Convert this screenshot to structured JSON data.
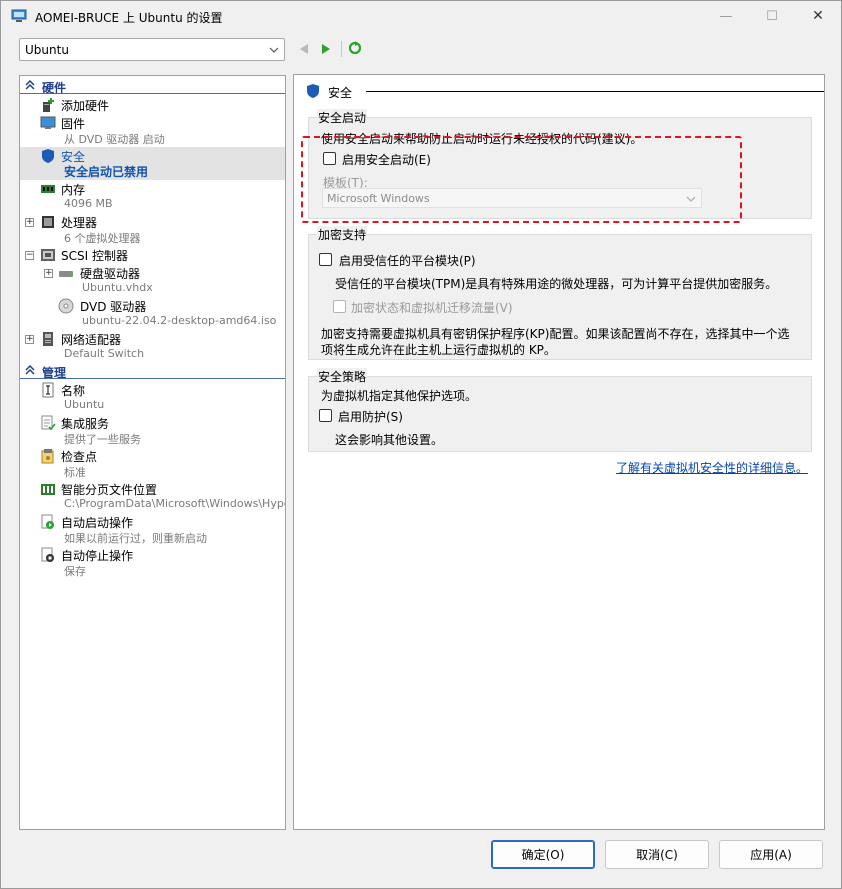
{
  "window": {
    "title": "AOMEI-BRUCE 上 Ubuntu 的设置",
    "min_glyph": "—",
    "max_glyph": "☐",
    "close_glyph": "✕"
  },
  "vm_selector": {
    "value": "Ubuntu"
  },
  "tree": {
    "hardware_label": "硬件",
    "management_label": "管理",
    "items": [
      {
        "label": "添加硬件",
        "sub": "",
        "icon": "add-hardware-icon"
      },
      {
        "label": "固件",
        "sub": "从 DVD 驱动器 启动",
        "icon": "firmware-icon"
      },
      {
        "label": "安全",
        "sub": "安全启动已禁用",
        "icon": "shield-icon"
      },
      {
        "label": "内存",
        "sub": "4096 MB",
        "icon": "memory-icon"
      },
      {
        "label": "处理器",
        "sub": "6 个虚拟处理器",
        "icon": "processor-icon"
      },
      {
        "label": "SCSI 控制器",
        "sub": "",
        "icon": "scsi-controller-icon"
      },
      {
        "label": "硬盘驱动器",
        "sub": "Ubuntu.vhdx",
        "icon": "hard-drive-icon"
      },
      {
        "label": "DVD 驱动器",
        "sub": "ubuntu-22.04.2-desktop-amd64.iso",
        "icon": "dvd-drive-icon"
      },
      {
        "label": "网络适配器",
        "sub": "Default Switch",
        "icon": "network-adapter-icon"
      }
    ],
    "mgmt_items": [
      {
        "label": "名称",
        "sub": "Ubuntu",
        "icon": "name-icon"
      },
      {
        "label": "集成服务",
        "sub": "提供了一些服务",
        "icon": "integration-services-icon"
      },
      {
        "label": "检查点",
        "sub": "标准",
        "icon": "checkpoint-icon"
      },
      {
        "label": "智能分页文件位置",
        "sub": "C:\\ProgramData\\Microsoft\\Windows\\Hyper-V",
        "icon": "smart-paging-icon"
      },
      {
        "label": "自动启动操作",
        "sub": "如果以前运行过，则重新启动",
        "icon": "auto-start-icon"
      },
      {
        "label": "自动停止操作",
        "sub": "保存",
        "icon": "auto-stop-icon"
      }
    ]
  },
  "pane": {
    "heading": "安全",
    "secure_boot": {
      "title": "安全启动",
      "desc": "使用安全启动来帮助防止启动时运行未经授权的代码(建议)。",
      "enable_label": "启用安全启动(E)",
      "template_label": "模板(T):",
      "template_value": "Microsoft Windows"
    },
    "encryption": {
      "title": "加密支持",
      "tpm_label": "启用受信任的平台模块(P)",
      "tpm_desc": "受信任的平台模块(TPM)是具有特殊用途的微处理器，可为计算平台提供加密服务。",
      "encrypt_label": "加密状态和虚拟机迁移流量(V)",
      "kp_desc_1": "加密支持需要虚拟机具有密钥保护程序(KP)配置。如果该配置尚不存在，选择其中一个选",
      "kp_desc_2": "项将生成允许在此主机上运行虚拟机的 KP。"
    },
    "policy": {
      "title": "安全策略",
      "desc": "为虚拟机指定其他保护选项。",
      "shield_label": "启用防护(S)",
      "shield_desc": "这会影响其他设置。"
    },
    "link": "了解有关虚拟机安全性的详细信息。"
  },
  "buttons": {
    "ok": "确定(O)",
    "cancel": "取消(C)",
    "apply": "应用(A)"
  },
  "colors": {
    "accent": "#1254ae",
    "highlight": "#e0141e",
    "link": "#0645ad"
  }
}
